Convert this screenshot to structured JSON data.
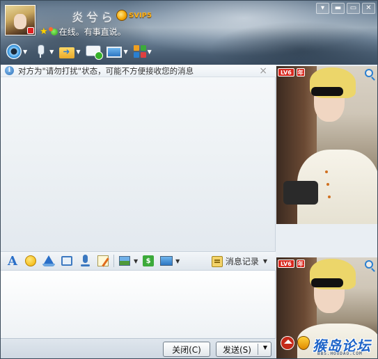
{
  "header": {
    "nickname": "炎兮ら",
    "vip_badge": "SVIP5",
    "status_text": "在线。有事直说。",
    "window_buttons": [
      "▾",
      "▬",
      "▭",
      "✕"
    ]
  },
  "toolbar": {
    "items": [
      {
        "name": "video",
        "icon": "camera-icon"
      },
      {
        "name": "voice",
        "icon": "microphone-icon"
      },
      {
        "name": "file-transfer",
        "icon": "folder-transfer-icon"
      },
      {
        "name": "group-chat",
        "icon": "chat-bubble-icon"
      },
      {
        "name": "remote",
        "icon": "monitor-icon"
      },
      {
        "name": "apps",
        "icon": "apps-grid-icon"
      }
    ]
  },
  "notice": {
    "text": "对方为\"请勿打扰\"状态，可能不方便接收您的消息",
    "close_label": "×"
  },
  "input_toolbar": {
    "font_label": "A",
    "history_label": "消息记录"
  },
  "photos": {
    "level_label": "LV6",
    "year_label": "年"
  },
  "buttons": {
    "close_label": "关闭(C)",
    "send_label": "发送(S)"
  },
  "watermark": {
    "text": "猴岛论坛",
    "sub": "BBS.HOUDAO.COM"
  },
  "colors": {
    "accent": "#2a6fc8",
    "vip": "#ffb21a",
    "online": "#37b22a"
  }
}
